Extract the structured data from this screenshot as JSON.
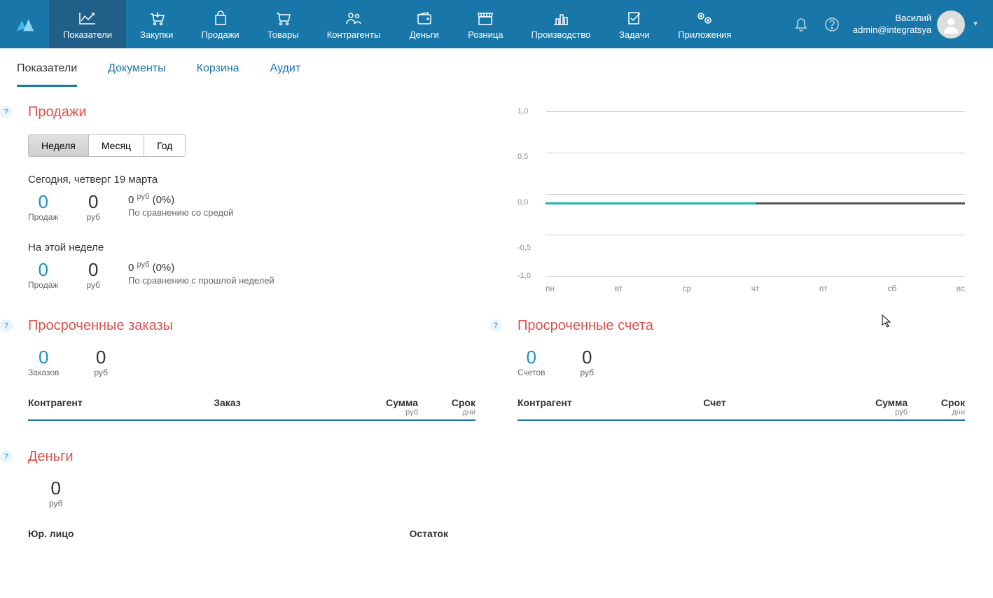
{
  "nav": {
    "items": [
      {
        "label": "Показатели"
      },
      {
        "label": "Закупки"
      },
      {
        "label": "Продажи"
      },
      {
        "label": "Товары"
      },
      {
        "label": "Контрагенты"
      },
      {
        "label": "Деньги"
      },
      {
        "label": "Розница"
      },
      {
        "label": "Производство"
      },
      {
        "label": "Задачи"
      },
      {
        "label": "Приложения"
      }
    ]
  },
  "user": {
    "name": "Василий",
    "email": "admin@integratsya"
  },
  "subtabs": [
    "Показатели",
    "Документы",
    "Корзина",
    "Аудит"
  ],
  "sales": {
    "title": "Продажи",
    "periods": [
      "Неделя",
      "Месяц",
      "Год"
    ],
    "today_label": "Сегодня, четверг 19 марта",
    "today": {
      "count": "0",
      "count_label": "Продаж",
      "sum": "0",
      "sum_label": "руб",
      "cmp_val": "0",
      "cmp_cur": "руб",
      "cmp_pct": "(0%)",
      "cmp_text": "По сравнению со средой"
    },
    "week_label": "На этой неделе",
    "week": {
      "count": "0",
      "count_label": "Продаж",
      "sum": "0",
      "sum_label": "руб",
      "cmp_val": "0",
      "cmp_cur": "руб",
      "cmp_pct": "(0%)",
      "cmp_text": "По сравнению с прошлой неделей"
    }
  },
  "chart_data": {
    "type": "line",
    "title": "",
    "xlabel": "",
    "ylabel": "",
    "ylim": [
      -1.0,
      1.0
    ],
    "yticks": [
      "1,0",
      "0,5",
      "0,0",
      "-0,5",
      "-1,0"
    ],
    "categories": [
      "пн",
      "вт",
      "ср",
      "чт",
      "пт",
      "сб",
      "вс"
    ],
    "series": [
      {
        "name": "sales",
        "color": "#1cb5b0",
        "values": [
          0,
          0,
          0,
          0,
          null,
          null,
          null
        ]
      }
    ]
  },
  "overdue_orders": {
    "title": "Просроченные заказы",
    "count": "0",
    "count_label": "Заказов",
    "sum": "0",
    "sum_label": "руб",
    "cols": {
      "a": "Контрагент",
      "b": "Заказ",
      "c": "Сумма",
      "c_sub": "руб",
      "d": "Срок",
      "d_sub": "дни"
    }
  },
  "overdue_invoices": {
    "title": "Просроченные счета",
    "count": "0",
    "count_label": "Счетов",
    "sum": "0",
    "sum_label": "руб",
    "cols": {
      "a": "Контрагент",
      "b": "Счет",
      "c": "Сумма",
      "c_sub": "руб",
      "d": "Срок",
      "d_sub": "дни"
    }
  },
  "money": {
    "title": "Деньги",
    "sum": "0",
    "sum_label": "руб",
    "cols": {
      "a": "Юр. лицо",
      "b": "Остаток"
    }
  }
}
